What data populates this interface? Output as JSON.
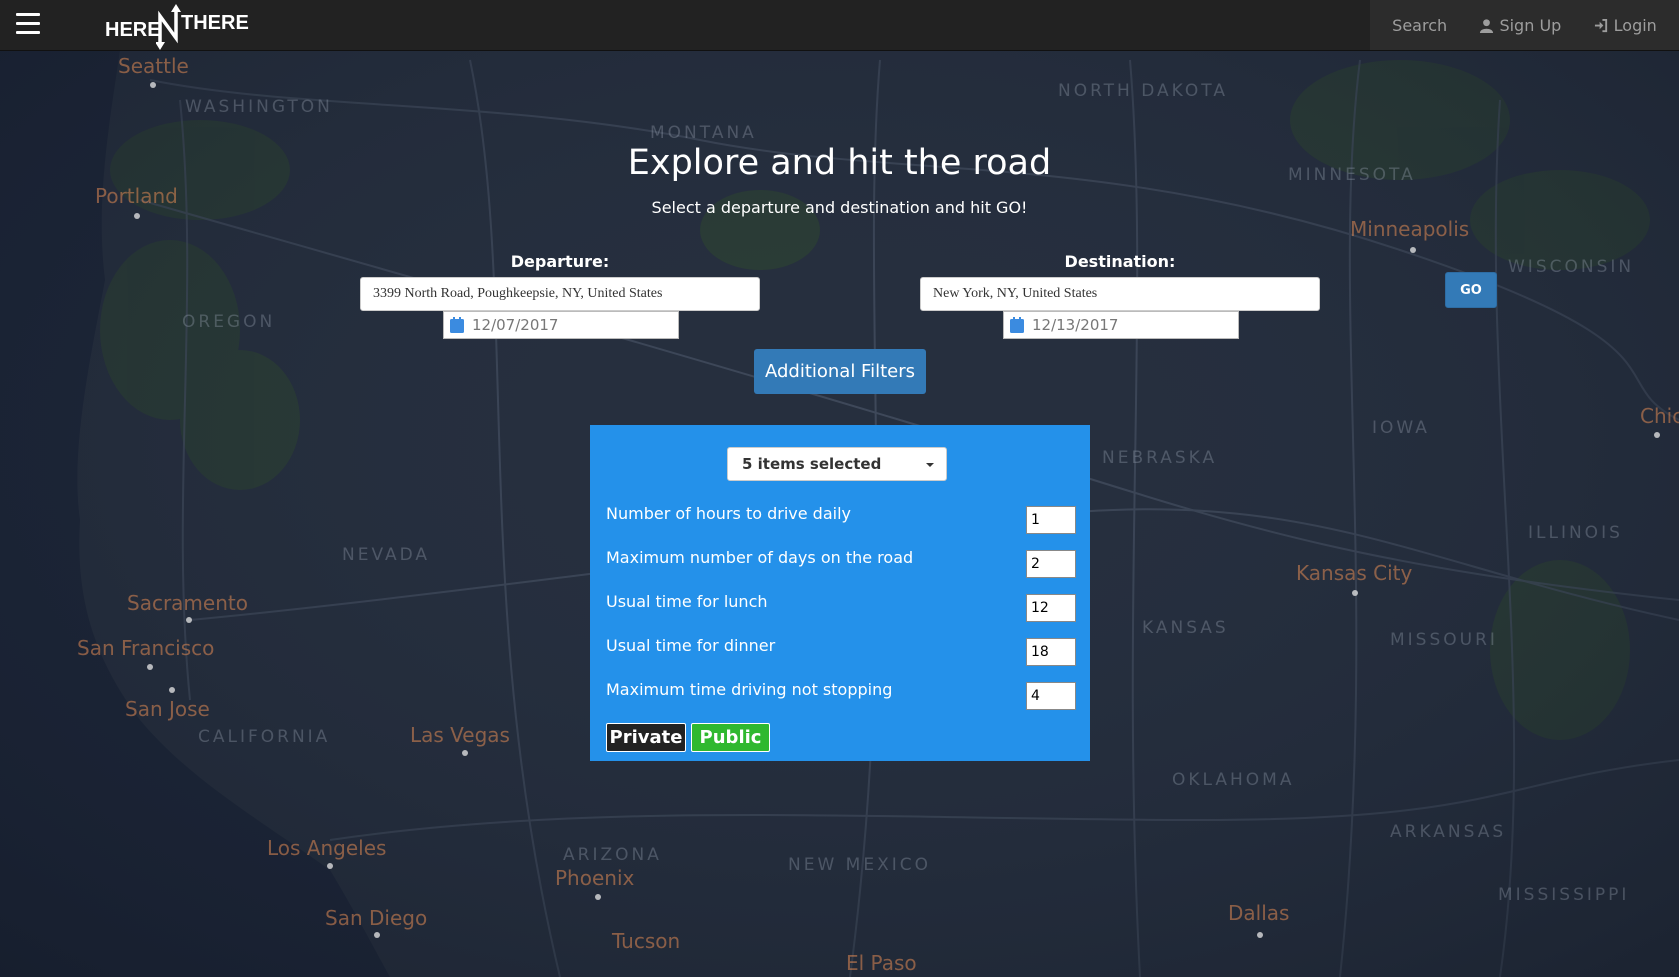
{
  "navbar": {
    "logo_left": "HERE",
    "logo_right": "THERE",
    "search_label": "Search",
    "signup_label": "Sign Up",
    "login_label": "Login"
  },
  "map": {
    "cities": [
      "Seattle",
      "Portland",
      "Sacramento",
      "San Francisco",
      "San Jose",
      "Las Vegas",
      "Los Angeles",
      "San Diego",
      "Phoenix",
      "Tucson",
      "El Paso",
      "Dallas",
      "Kansas City",
      "Minneapolis",
      "Chicago"
    ],
    "states": [
      "WASHINGTON",
      "OREGON",
      "NEVADA",
      "CALIFORNIA",
      "MONTANA",
      "ARIZONA",
      "NEW MEXICO",
      "NORTH DAKOTA",
      "MINNESOTA",
      "WISCONSIN",
      "IOWA",
      "NEBRASKA",
      "KANSAS",
      "MISSOURI",
      "ILLINOIS",
      "OKLAHOMA",
      "ARKANSAS",
      "MISSISSIPPI"
    ]
  },
  "hero": {
    "title": "Explore and hit the road",
    "subtitle": "Select a departure and destination and hit GO!"
  },
  "departure": {
    "label": "Departure:",
    "value": "3399 North Road, Poughkeepsie, NY, United States",
    "date": "12/07/2017"
  },
  "destination": {
    "label": "Destination:",
    "value": "New York, NY, United States",
    "date": "12/13/2017"
  },
  "go_label": "GO",
  "filters_label": "Additional Filters",
  "panel": {
    "multiselect": "5 items selected",
    "rows": [
      {
        "label": "Number of hours to drive daily",
        "value": "1"
      },
      {
        "label": "Maximum number of days on the road",
        "value": "2"
      },
      {
        "label": "Usual time for lunch",
        "value": "12"
      },
      {
        "label": "Usual time for dinner",
        "value": "18"
      },
      {
        "label": "Maximum time driving not stopping",
        "value": "4"
      }
    ],
    "private_label": "Private",
    "public_label": "Public"
  }
}
